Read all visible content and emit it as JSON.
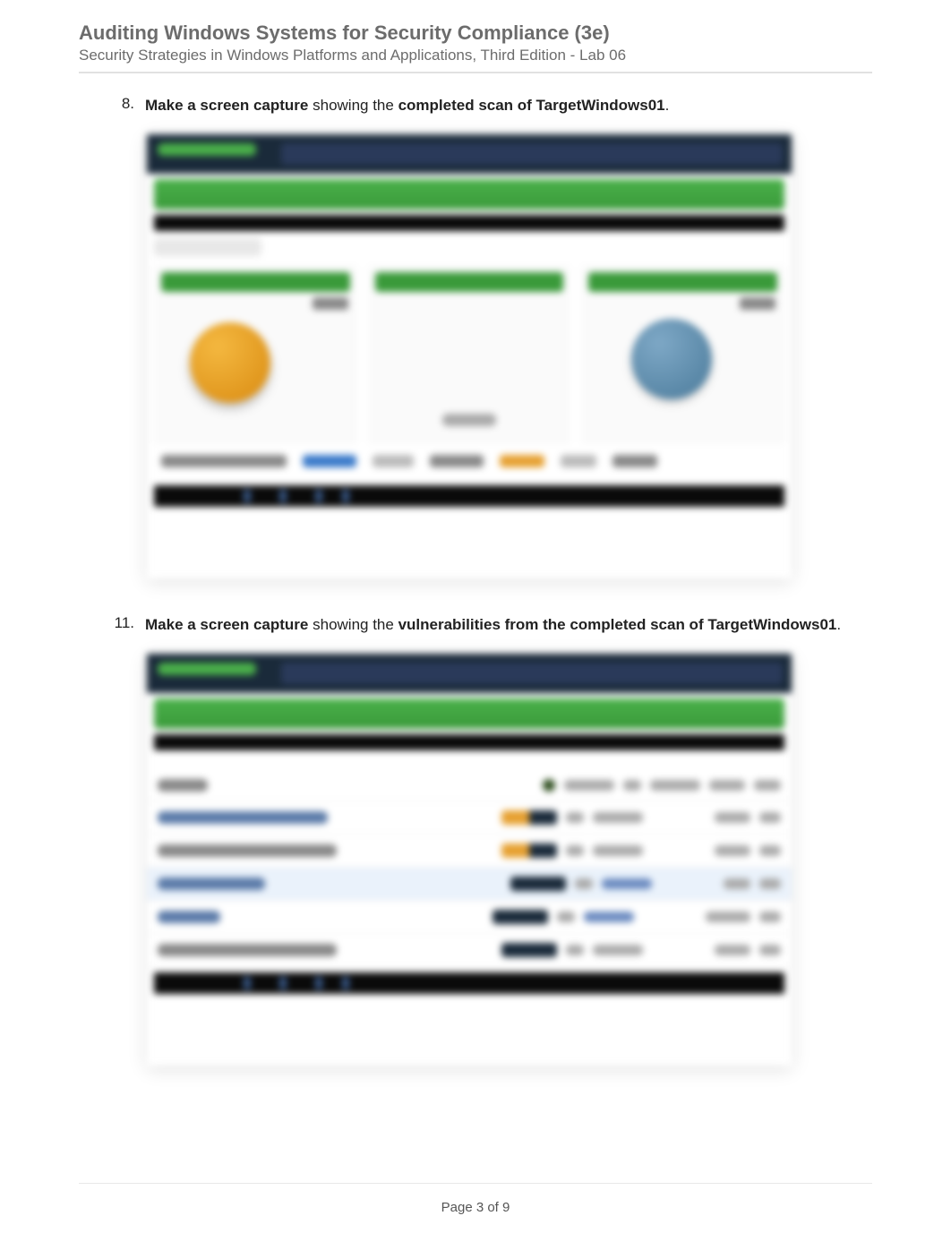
{
  "header": {
    "title": "Auditing Windows Systems for Security Compliance (3e)",
    "subtitle": "Security Strategies in Windows Platforms and Applications, Third Edition - Lab 06"
  },
  "instructions": [
    {
      "number": "8.",
      "prefix": "Make a screen capture",
      "middle": " showing the ",
      "boldTarget": "completed scan of TargetWindows01",
      "suffix": "."
    },
    {
      "number": "11.",
      "prefix": "Make a screen capture",
      "middle": " showing the ",
      "boldTarget": "vulnerabilities from the completed scan of TargetWindows01",
      "suffix": "."
    }
  ],
  "footer": {
    "pageLabel": "Page 3 of 9"
  },
  "screenshots": {
    "note": "Embedded screenshots are blurred application captures; detailed textual content is not legible. Visual placeholders reproduce approximate layout and colors (green nav bar, pie charts in orange and blue, vulnerability table rows, dark footer bar)."
  }
}
